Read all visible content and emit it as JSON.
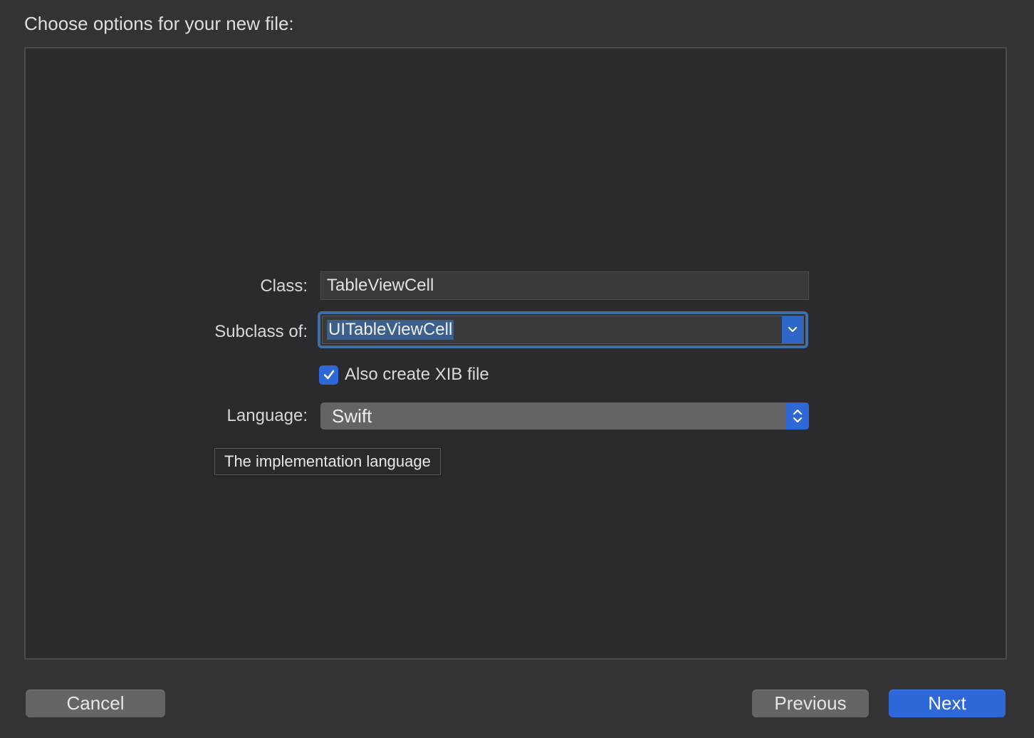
{
  "header": {
    "title": "Choose options for your new file:"
  },
  "form": {
    "class_label": "Class:",
    "class_value": "TableViewCell",
    "subclass_label": "Subclass of:",
    "subclass_value": "UITableViewCell",
    "xib_checkbox_label": "Also create XIB file",
    "xib_checked": true,
    "language_label": "Language:",
    "language_value": "Swift"
  },
  "tooltip": {
    "text": "The implementation language"
  },
  "buttons": {
    "cancel": "Cancel",
    "previous": "Previous",
    "next": "Next"
  },
  "icons": {
    "combo_arrow": "chevron-down-icon",
    "popup_arrows": "up-down-chevron-icon",
    "checkbox": "checkmark-icon"
  },
  "colors": {
    "accent": "#2e67d8",
    "focus_ring": "#3f6fa6",
    "background": "#333336"
  }
}
